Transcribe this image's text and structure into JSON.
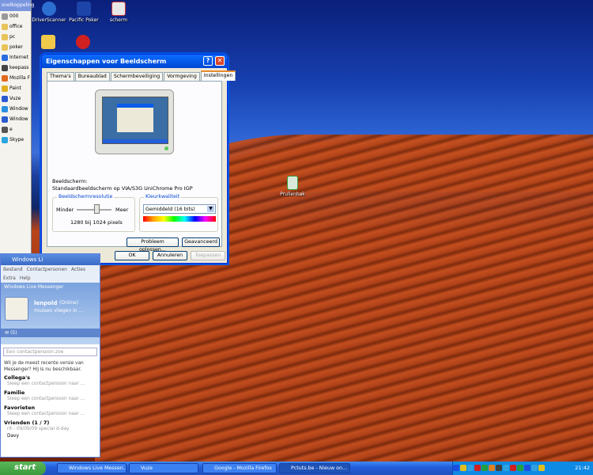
{
  "desktop": {
    "icons": [
      {
        "label": "DriverScanner",
        "color": "#2d6fd1"
      },
      {
        "label": "Pacific Poker",
        "color": "#1d44a8"
      },
      {
        "label": "scherm",
        "color": "#e8e8e8"
      },
      {
        "label": "Prullenbak",
        "color": "#3aa03a"
      }
    ]
  },
  "quicklaunch": {
    "header": "snelkoppeling",
    "items": [
      {
        "label": "000",
        "color": "#999"
      },
      {
        "label": "office",
        "color": "#e8c35a"
      },
      {
        "label": "pc",
        "color": "#e8c35a"
      },
      {
        "label": "poker",
        "color": "#e8c35a"
      },
      {
        "label": "Internet",
        "color": "#2b6ce0"
      },
      {
        "label": "keepass",
        "color": "#444"
      },
      {
        "label": "Mozilla F",
        "color": "#e06b1c"
      },
      {
        "label": "Paint",
        "color": "#e0b020"
      },
      {
        "label": "Vuze",
        "color": "#2a5bd0"
      },
      {
        "label": "Window",
        "color": "#2a8fe0"
      },
      {
        "label": "Window",
        "color": "#2a5bd0"
      },
      {
        "label": "e",
        "color": "#555"
      },
      {
        "label": "Skype",
        "color": "#2aa4e0"
      }
    ]
  },
  "dialog": {
    "title": "Eigenschappen voor Beeldscherm",
    "tabs": [
      "Thema's",
      "Bureaublad",
      "Schermbeveiliging",
      "Vormgeving",
      "Instellingen"
    ],
    "active_tab": "Instellingen",
    "display_label": "Beeldscherm:",
    "display_value": "Standaardbeeldscherm op VIA/S3G UniChrome Pro IGP",
    "resolution": {
      "title": "Beeldschermresolutie",
      "less": "Minder",
      "more": "Meer",
      "value": "1280 bij 1024 pixels"
    },
    "color": {
      "title": "Kleurkwaliteit",
      "selected": "Gemiddeld (16 bits)"
    },
    "troubleshoot_button": "Probleem oplossen...",
    "advanced_button": "Geavanceerd",
    "ok_button": "OK",
    "cancel_button": "Annuleren",
    "apply_button": "Toepassen"
  },
  "messenger": {
    "window_title": "Windows Live Messenger",
    "window_title_short": "Windows Li",
    "menu": [
      "Bestand",
      "Contactpersonen",
      "Acties",
      "Extra",
      "Help"
    ],
    "user_name": "lenpold",
    "status": "(Online)",
    "personal_message": "mussen vliegen in ...",
    "count": "(5)",
    "search_placeholder": "Een contactpersoon zoe",
    "notice": "Wil je de meest recente versie van Messenger? Hij is nu beschikbaar.",
    "groups": [
      {
        "name": "Collega's",
        "hint": "Sleep een contactpersoon naar ..."
      },
      {
        "name": "Familie",
        "hint": "Sleep een contactpersoon naar ..."
      },
      {
        "name": "Favorieten",
        "hint": "Sleep een contactpersoon naar ..."
      },
      {
        "name": "Vrienden (1 / 7)",
        "hint": "rit - 09/09/09 special d-day"
      }
    ],
    "last_contact": "Davy"
  },
  "taskbar": {
    "start": "start",
    "tasks": [
      {
        "label": "Windows Live Messen...",
        "active": false
      },
      {
        "label": "Vuze",
        "active": false
      },
      {
        "label": "Google - Mozilla Firefox",
        "active": false
      },
      {
        "label": "Pctuts.be - Nieuw on...",
        "active": true
      }
    ],
    "clock": "21:42"
  }
}
